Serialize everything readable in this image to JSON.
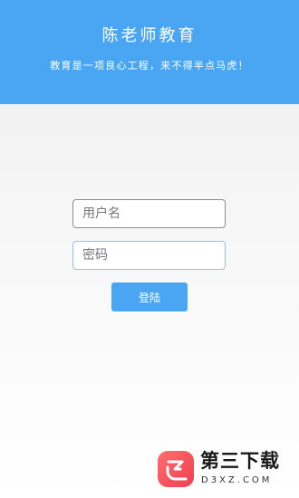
{
  "header": {
    "title": "陈老师教育",
    "slogan": "教育是一项良心工程，来不得半点马虎！"
  },
  "form": {
    "username_placeholder": "用户名",
    "username_value": "",
    "password_placeholder": "密码",
    "password_value": "",
    "login_label": "登陆"
  },
  "watermark": {
    "icon": "d3xz-logo-icon",
    "name": "第三下载",
    "domain": "D3XZ.COM"
  },
  "colors": {
    "brand_blue": "#4aa6f2",
    "watermark_red": "#ee3e4f"
  }
}
